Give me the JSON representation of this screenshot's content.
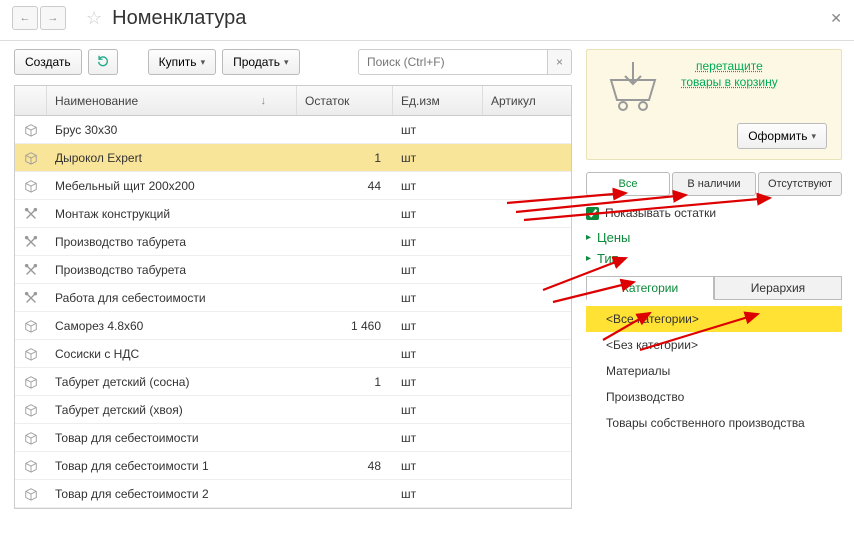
{
  "header": {
    "title": "Номенклатура"
  },
  "toolbar": {
    "create": "Создать",
    "buy": "Купить",
    "sell": "Продать",
    "search_placeholder": "Поиск (Ctrl+F)"
  },
  "columns": {
    "name": "Наименование",
    "rest": "Остаток",
    "unit": "Ед.изм",
    "article": "Артикул"
  },
  "rows": [
    {
      "icon": "box",
      "name": "Брус 30х30",
      "rest": "",
      "unit": "шт",
      "selected": false
    },
    {
      "icon": "box",
      "name": "Дырокол Expert",
      "rest": "1",
      "unit": "шт",
      "selected": true
    },
    {
      "icon": "box",
      "name": "Мебельный щит 200x200",
      "rest": "44",
      "unit": "шт",
      "selected": false
    },
    {
      "icon": "tools",
      "name": "Монтаж конструкций",
      "rest": "",
      "unit": "шт",
      "selected": false
    },
    {
      "icon": "tools",
      "name": "Производство табурета",
      "rest": "",
      "unit": "шт",
      "selected": false
    },
    {
      "icon": "tools",
      "name": "Производство табурета",
      "rest": "",
      "unit": "шт",
      "selected": false
    },
    {
      "icon": "tools",
      "name": "Работа для себестоимости",
      "rest": "",
      "unit": "шт",
      "selected": false
    },
    {
      "icon": "box",
      "name": "Саморез 4.8х60",
      "rest": "1 460",
      "unit": "шт",
      "selected": false
    },
    {
      "icon": "box",
      "name": "Сосиски с НДС",
      "rest": "",
      "unit": "шт",
      "selected": false
    },
    {
      "icon": "box",
      "name": "Табурет детский (сосна)",
      "rest": "1",
      "unit": "шт",
      "selected": false
    },
    {
      "icon": "box",
      "name": "Табурет детский (хвоя)",
      "rest": "",
      "unit": "шт",
      "selected": false
    },
    {
      "icon": "box",
      "name": "Товар для себестоимости",
      "rest": "",
      "unit": "шт",
      "selected": false
    },
    {
      "icon": "box",
      "name": "Товар для себестоимости 1",
      "rest": "48",
      "unit": "шт",
      "selected": false
    },
    {
      "icon": "box",
      "name": "Товар для себестоимости 2",
      "rest": "",
      "unit": "шт",
      "selected": false
    }
  ],
  "cart": {
    "line1": "перетащите",
    "line2": "товары в корзину",
    "submit": "Оформить"
  },
  "filters": {
    "all": "Все",
    "in_stock": "В наличии",
    "absent": "Отсутствуют",
    "show_rest": "Показывать остатки"
  },
  "sections": {
    "prices": "Цены",
    "type": "Тип"
  },
  "cat_tabs": {
    "categories": "Категории",
    "hierarchy": "Иерархия"
  },
  "categories": [
    {
      "label": "<Все категории>",
      "selected": true
    },
    {
      "label": "<Без категории>",
      "selected": false
    },
    {
      "label": "Материалы",
      "selected": false
    },
    {
      "label": "Производство",
      "selected": false
    },
    {
      "label": "Товары собственного производства",
      "selected": false
    }
  ]
}
